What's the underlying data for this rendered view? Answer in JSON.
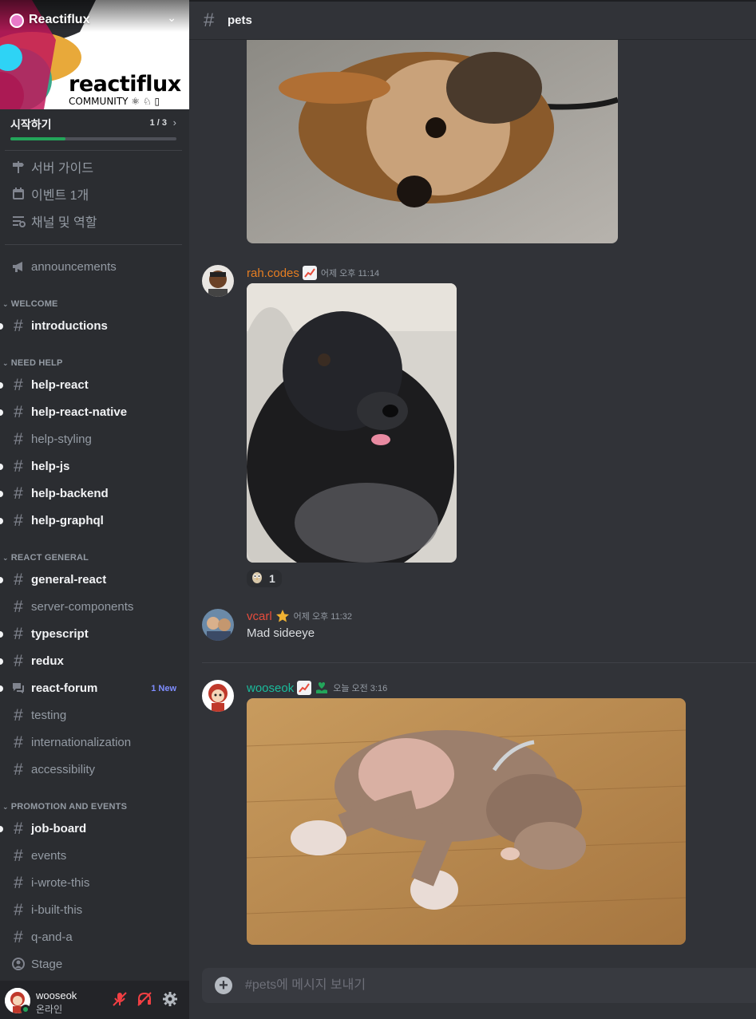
{
  "server": {
    "name": "Reactiflux",
    "logo_text": "reactiflux",
    "logo_sub": "COMMUNITY ⚛ ♘ ▯"
  },
  "onboarding": {
    "label": "시작하기",
    "count": "1 / 3",
    "progress_fraction": 0.33
  },
  "guide": [
    {
      "label": "서버 가이드",
      "icon": "signpost-icon"
    },
    {
      "label": "이벤트 1개",
      "icon": "calendar-icon"
    },
    {
      "label": "채널 및 역할",
      "icon": "channels-roles-icon"
    }
  ],
  "channels": {
    "announcements": "announcements",
    "welcome": {
      "title": "WELCOME",
      "items": [
        "introductions"
      ]
    },
    "need_help": {
      "title": "NEED HELP",
      "items": [
        "help-react",
        "help-react-native",
        "help-styling",
        "help-js",
        "help-backend",
        "help-graphql"
      ]
    },
    "react_general": {
      "title": "REACT GENERAL",
      "items": [
        "general-react",
        "server-components",
        "typescript",
        "redux",
        "react-forum",
        "testing",
        "internationalization",
        "accessibility"
      ],
      "forum_badge": "1 New"
    },
    "promotion": {
      "title": "PROMOTION AND EVENTS",
      "items": [
        "job-board",
        "events",
        "i-wrote-this",
        "i-built-this",
        "q-and-a",
        "Stage"
      ]
    }
  },
  "user": {
    "name": "wooseok",
    "status": "온라인"
  },
  "topbar": {
    "channel": "pets"
  },
  "messages": [
    {
      "author": "rah.codes",
      "author_color": "#e67e22",
      "timestamp": "어제 오후 11:14",
      "reaction_count": "1",
      "reaction_icon": "owl-emoji"
    },
    {
      "author": "vcarl",
      "author_color": "#e74c3c",
      "timestamp": "어제 오후 11:32",
      "text": "Mad sideeye"
    },
    {
      "author": "wooseok",
      "author_color": "#1abc9c",
      "timestamp": "오늘 오전 3:16"
    }
  ],
  "composer": {
    "placeholder": "#pets에 메시지 보내기"
  },
  "colors": {
    "sidebar_bg": "#2b2d31",
    "main_bg": "#313338",
    "progress": "#23a55a",
    "new_badge": "#7f8dff",
    "muted_red": "#f23f43"
  }
}
